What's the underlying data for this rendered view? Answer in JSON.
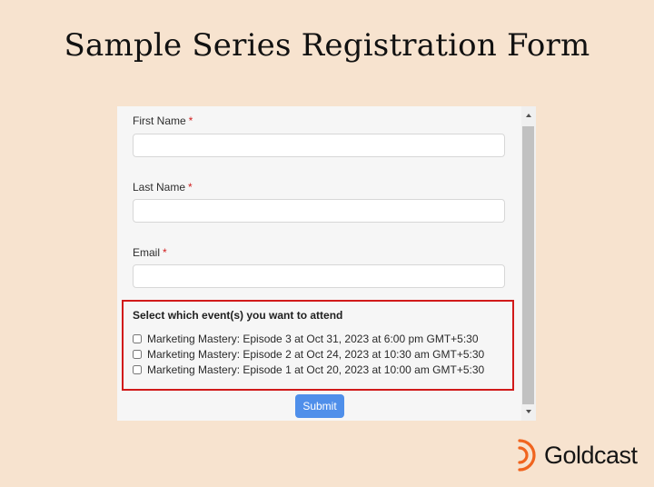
{
  "page": {
    "title": "Sample Series Registration Form"
  },
  "form": {
    "first_name": {
      "label": "First Name",
      "required_mark": "*",
      "value": ""
    },
    "last_name": {
      "label": "Last Name",
      "required_mark": "*",
      "value": ""
    },
    "email": {
      "label": "Email",
      "required_mark": "*",
      "value": ""
    },
    "events": {
      "heading": "Select which event(s) you want to attend",
      "options": [
        {
          "label": "Marketing Mastery: Episode 3 at Oct 31, 2023 at 6:00 pm GMT+5:30",
          "checked": false
        },
        {
          "label": "Marketing Mastery: Episode 2 at Oct 24, 2023 at 10:30 am GMT+5:30",
          "checked": false
        },
        {
          "label": "Marketing Mastery: Episode 1 at Oct 20, 2023 at 10:00 am GMT+5:30",
          "checked": false
        }
      ]
    },
    "submit_label": "Submit"
  },
  "brand": {
    "name": "Goldcast",
    "logo_icon": "goldcast-logo-icon",
    "logo_color": "#f0641e"
  },
  "colors": {
    "background": "#f7e3cf",
    "form_background": "#f6f6f6",
    "highlight_border": "#d11a1a",
    "submit_button": "#4f8fea",
    "required": "#d21f1f"
  }
}
